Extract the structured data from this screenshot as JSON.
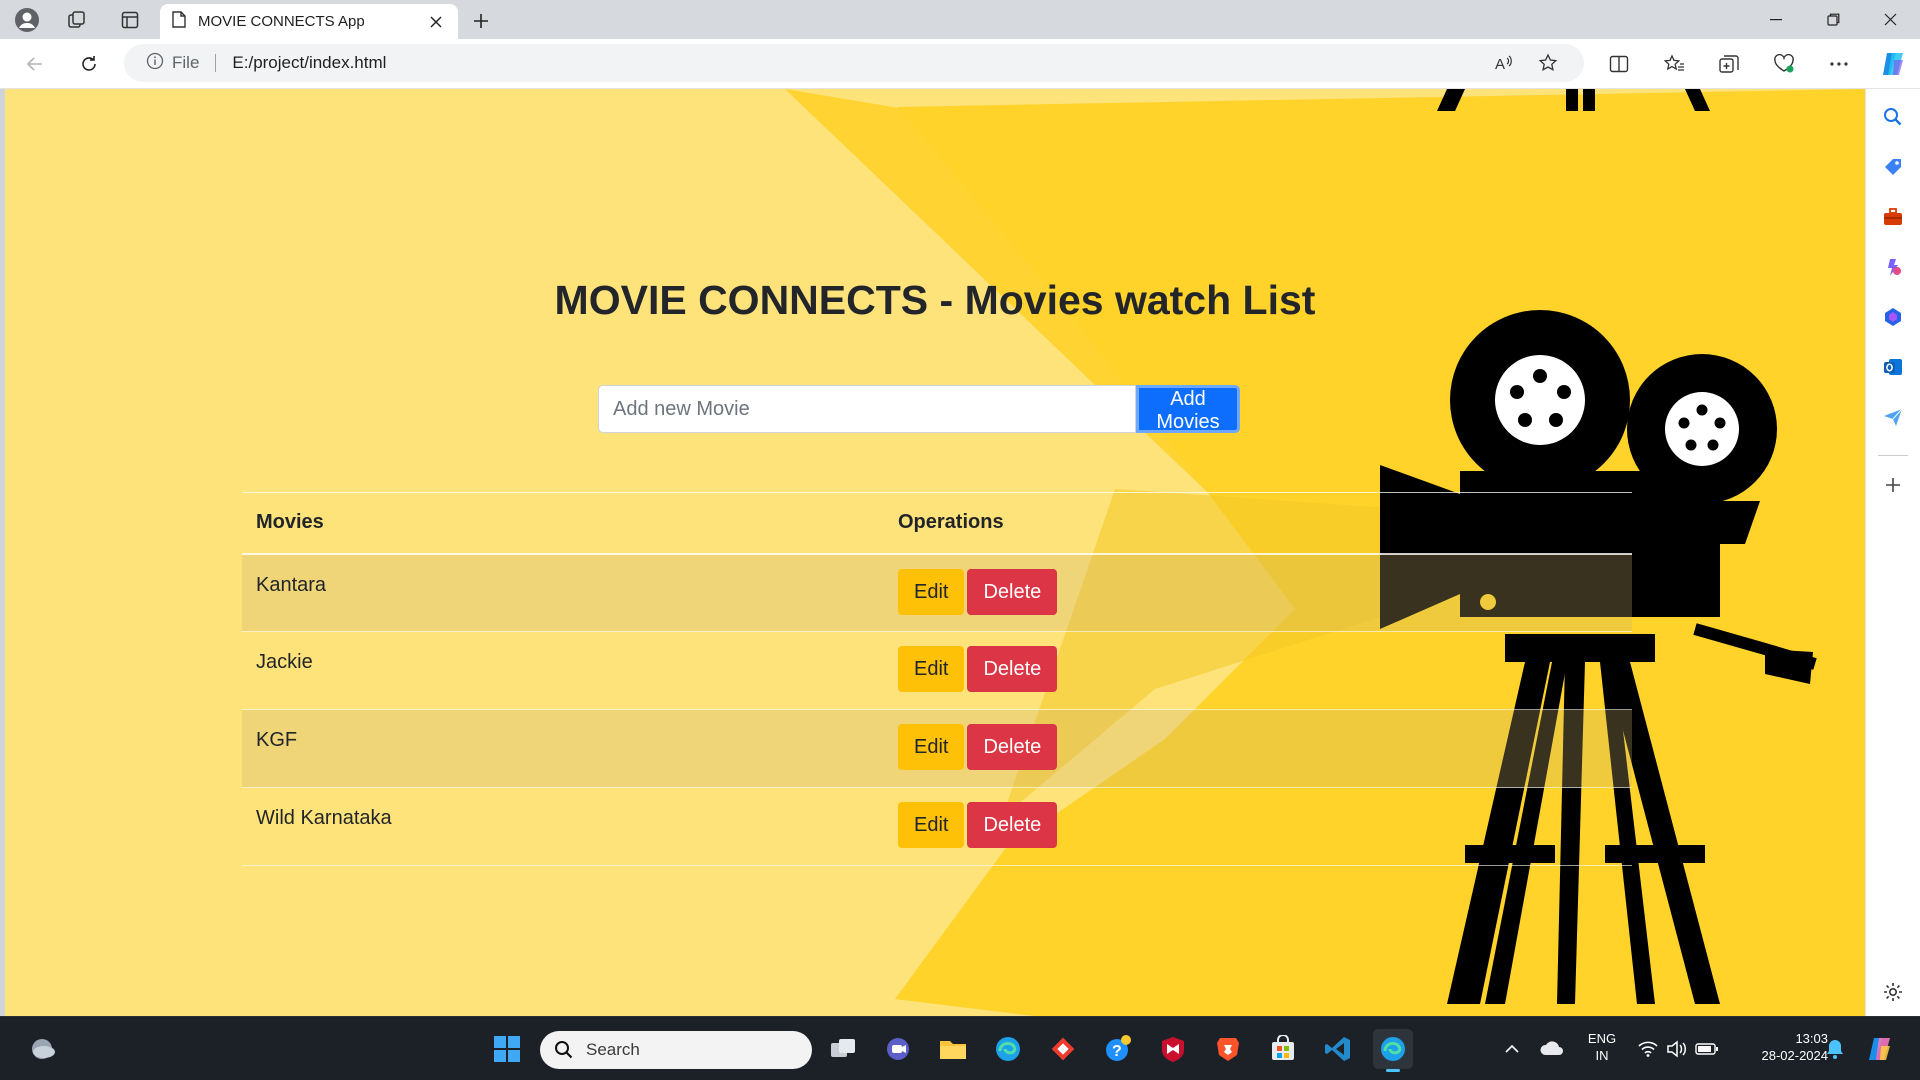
{
  "browser": {
    "tab_title": "MOVIE CONNECTS App",
    "file_label": "File",
    "url": "E:/project/index.html"
  },
  "page": {
    "heading": "MOVIE CONNECTS - Movies watch List",
    "input_placeholder": "Add new Movie",
    "add_button": "Add Movies",
    "table": {
      "headers": [
        "Movies",
        "Operations"
      ],
      "rows": [
        {
          "name": "Kantara",
          "edit": "Edit",
          "delete": "Delete"
        },
        {
          "name": "Jackie",
          "edit": "Edit",
          "delete": "Delete"
        },
        {
          "name": "KGF",
          "edit": "Edit",
          "delete": "Delete"
        },
        {
          "name": "Wild Karnataka",
          "edit": "Edit",
          "delete": "Delete"
        }
      ]
    },
    "colors": {
      "background": "#fee27a",
      "accent_yellow": "#ffd32a",
      "primary": "#0d6efd",
      "warning": "#ffc107",
      "danger": "#dc3545"
    }
  },
  "taskbar": {
    "search_label": "Search",
    "lang_line1": "ENG",
    "lang_line2": "IN",
    "time": "13:03",
    "date": "28-02-2024"
  }
}
